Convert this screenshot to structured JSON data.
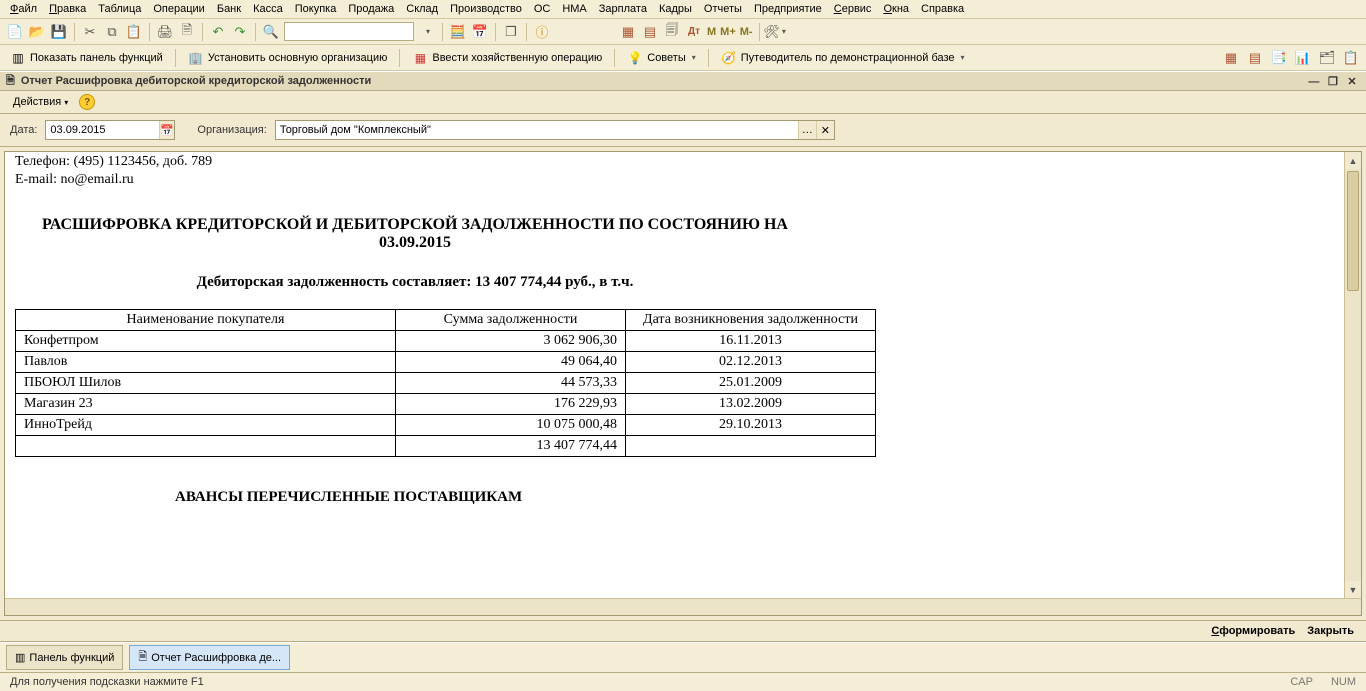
{
  "menu": [
    "Файл",
    "Правка",
    "Таблица",
    "Операции",
    "Банк",
    "Касса",
    "Покупка",
    "Продажа",
    "Склад",
    "Производство",
    "ОС",
    "НМА",
    "Зарплата",
    "Кадры",
    "Отчеты",
    "Предприятие",
    "Сервис",
    "Окна",
    "Справка"
  ],
  "toolbar1": {
    "search_placeholder": "",
    "m_labels": [
      "М",
      "М+",
      "М-"
    ]
  },
  "toolbar2": {
    "btn1": "Показать панель функций",
    "btn2": "Установить основную организацию",
    "btn3": "Ввести хозяйственную операцию",
    "btn4": "Советы",
    "btn5": "Путеводитель по демонстрационной базе"
  },
  "subwin": {
    "title": "Отчет  Расшифровка дебиторской кредиторской задолженности"
  },
  "actions": {
    "label": "Действия"
  },
  "filter": {
    "date_label": "Дата:",
    "date_value": "03.09.2015",
    "org_label": "Организация:",
    "org_value": "Торговый дом \"Комплексный\""
  },
  "doc": {
    "phone": "Телефон: (495) 1123456, доб. 789",
    "email": "E-mail: no@email.ru",
    "title1": "РАСШИФРОВКА КРЕДИТОРСКОЙ И ДЕБИТОРСКОЙ ЗАДОЛЖЕННОСТИ ПО СОСТОЯНИЮ НА",
    "title_date": "03.09.2015",
    "subtitle": "Дебиторская задолженность составляет: 13 407 774,44 руб., в т.ч.",
    "headers": [
      "Наименование покупателя",
      "Сумма задолженности",
      "Дата возникновения задолженности"
    ],
    "rows": [
      {
        "name": "Конфетпром",
        "sum": "3 062 906,30",
        "date": "16.11.2013"
      },
      {
        "name": "Павлов",
        "sum": "49 064,40",
        "date": "02.12.2013"
      },
      {
        "name": "ПБОЮЛ  Шилов",
        "sum": "44 573,33",
        "date": "25.01.2009"
      },
      {
        "name": "Магазин 23",
        "sum": "176 229,93",
        "date": "13.02.2009"
      },
      {
        "name": "ИнноТрейд",
        "sum": "10 075 000,48",
        "date": "29.10.2013"
      }
    ],
    "total": "13 407 774,44",
    "section2": "АВАНСЫ ПЕРЕЧИСЛЕННЫЕ ПОСТАВЩИКАМ"
  },
  "footer": {
    "run": "Сформировать",
    "close": "Закрыть"
  },
  "taskbar": {
    "t1": "Панель функций",
    "t2": "Отчет  Расшифровка де..."
  },
  "status": {
    "hint": "Для получения подсказки нажмите F1",
    "cap": "CAP",
    "num": "NUM"
  }
}
